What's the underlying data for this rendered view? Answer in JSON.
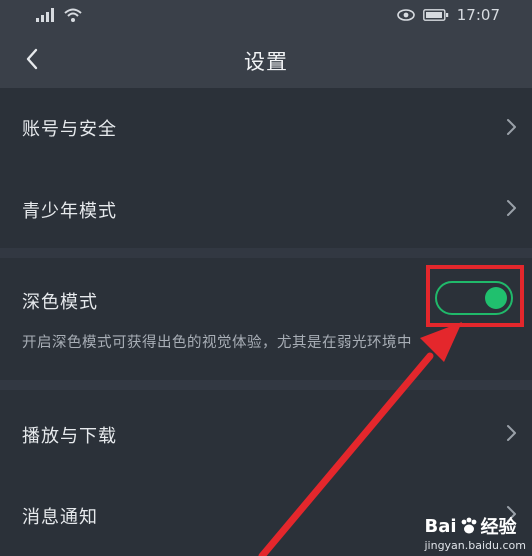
{
  "status": {
    "time": "17:07",
    "signal_icon": "signal-icon",
    "wifi_icon": "wifi-icon",
    "eye_icon": "eye-icon",
    "battery_icon": "battery-icon"
  },
  "header": {
    "title": "设置",
    "back_icon": "chevron-left-icon"
  },
  "items": [
    {
      "label": "账号与安全"
    },
    {
      "label": "青少年模式"
    },
    {
      "label": "深色模式",
      "description": "开启深色模式可获得出色的视觉体验，尤其是在弱光环境中",
      "toggle_on": true
    },
    {
      "label": "播放与下载"
    },
    {
      "label": "消息通知"
    }
  ],
  "watermark": {
    "brand": "Bai",
    "brand_suffix": "经验",
    "url": "jingyan.baidu.com"
  },
  "colors": {
    "accent": "#20c06e",
    "highlight": "#e4272c",
    "background": "#2b3139"
  }
}
